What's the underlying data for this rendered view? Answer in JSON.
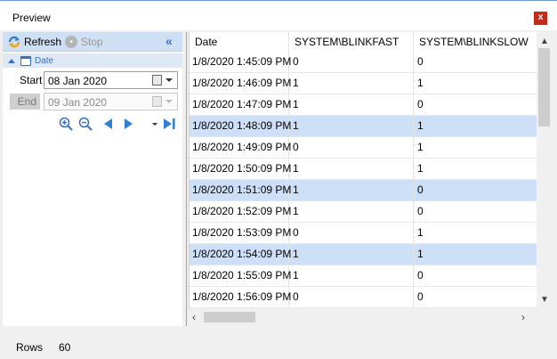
{
  "window": {
    "title": "Preview",
    "close_label": "x"
  },
  "toolbar": {
    "refresh_label": "Refresh",
    "stop_label": "Stop",
    "collapse_label": "«"
  },
  "filter": {
    "group_label": "Date",
    "start_label": "Start",
    "start_value": "08 Jan  2020",
    "end_label": "End",
    "end_value": "09 Jan  2020"
  },
  "icons": {
    "refresh": "refresh-icon",
    "stop": "stop-icon",
    "zoom_in": "zoom-in-icon",
    "zoom_out": "zoom-out-icon",
    "prev": "triangle-left-icon",
    "next": "triangle-right-icon",
    "dropdown": "small-dropdown-icon",
    "last": "skip-to-end-icon"
  },
  "grid": {
    "columns": [
      "Date",
      "SYSTEM\\BLINKFAST",
      "SYSTEM\\BLINKSLOW"
    ],
    "rows": [
      {
        "date": "1/8/2020 1:45:09 PM",
        "fast": "0",
        "slow": "0",
        "selected": false
      },
      {
        "date": "1/8/2020 1:46:09 PM",
        "fast": "1",
        "slow": "1",
        "selected": false
      },
      {
        "date": "1/8/2020 1:47:09 PM",
        "fast": "1",
        "slow": "0",
        "selected": false
      },
      {
        "date": "1/8/2020 1:48:09 PM",
        "fast": "1",
        "slow": "1",
        "selected": true
      },
      {
        "date": "1/8/2020 1:49:09 PM",
        "fast": "0",
        "slow": "1",
        "selected": false
      },
      {
        "date": "1/8/2020 1:50:09 PM",
        "fast": "1",
        "slow": "1",
        "selected": false
      },
      {
        "date": "1/8/2020 1:51:09 PM",
        "fast": "1",
        "slow": "0",
        "selected": true
      },
      {
        "date": "1/8/2020 1:52:09 PM",
        "fast": "1",
        "slow": "0",
        "selected": false
      },
      {
        "date": "1/8/2020 1:53:09 PM",
        "fast": "0",
        "slow": "1",
        "selected": false
      },
      {
        "date": "1/8/2020 1:54:09 PM",
        "fast": "1",
        "slow": "1",
        "selected": true
      },
      {
        "date": "1/8/2020 1:55:09 PM",
        "fast": "1",
        "slow": "0",
        "selected": false
      },
      {
        "date": "1/8/2020 1:56:09 PM",
        "fast": "0",
        "slow": "0",
        "selected": false
      }
    ]
  },
  "status": {
    "rows_label": "Rows",
    "rows_value": "60"
  },
  "colors": {
    "accent": "#3b6fc4",
    "selection": "#cde0f7",
    "toolbar": "#cfe0f5",
    "close": "#c42b1c"
  }
}
